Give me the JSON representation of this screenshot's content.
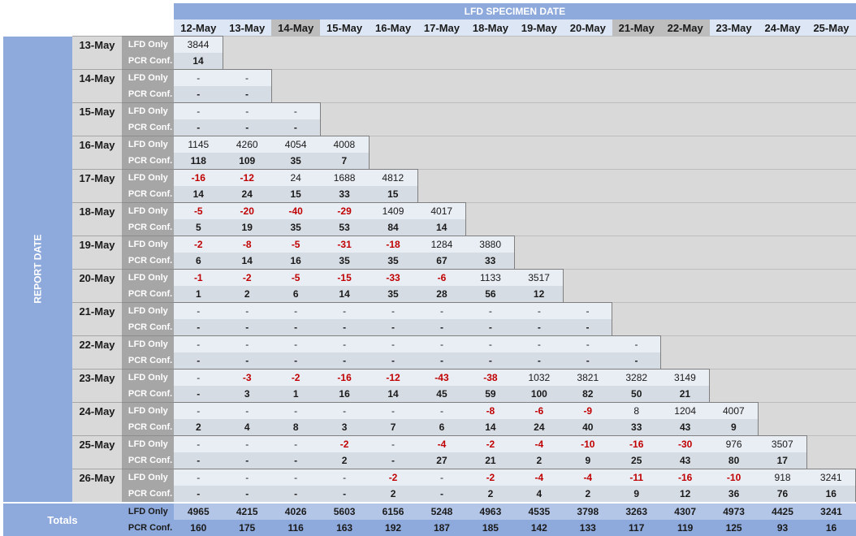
{
  "header": {
    "title": "LFD SPECIMEN DATE"
  },
  "axis_label": "REPORT DATE",
  "specimen_dates": [
    "12-May",
    "13-May",
    "14-May",
    "15-May",
    "16-May",
    "17-May",
    "18-May",
    "19-May",
    "20-May",
    "21-May",
    "22-May",
    "23-May",
    "24-May",
    "25-May"
  ],
  "weekend_columns": [
    2,
    9,
    10
  ],
  "row_types": {
    "lfd": "LFD Only",
    "pcr": "PCR Conf."
  },
  "report_rows": [
    {
      "date": "13-May",
      "lfd": [
        "3844"
      ],
      "pcr": [
        "14"
      ]
    },
    {
      "date": "14-May",
      "lfd": [
        "-",
        "-"
      ],
      "pcr": [
        "-",
        "-"
      ]
    },
    {
      "date": "15-May",
      "lfd": [
        "-",
        "-",
        "-"
      ],
      "pcr": [
        "-",
        "-",
        "-"
      ]
    },
    {
      "date": "16-May",
      "lfd": [
        "1145",
        "4260",
        "4054",
        "4008"
      ],
      "pcr": [
        "118",
        "109",
        "35",
        "7"
      ]
    },
    {
      "date": "17-May",
      "lfd": [
        "-16",
        "-12",
        "24",
        "1688",
        "4812"
      ],
      "pcr": [
        "14",
        "24",
        "15",
        "33",
        "15"
      ]
    },
    {
      "date": "18-May",
      "lfd": [
        "-5",
        "-20",
        "-40",
        "-29",
        "1409",
        "4017"
      ],
      "pcr": [
        "5",
        "19",
        "35",
        "53",
        "84",
        "14"
      ]
    },
    {
      "date": "19-May",
      "lfd": [
        "-2",
        "-8",
        "-5",
        "-31",
        "-18",
        "1284",
        "3880"
      ],
      "pcr": [
        "6",
        "14",
        "16",
        "35",
        "35",
        "67",
        "33"
      ]
    },
    {
      "date": "20-May",
      "lfd": [
        "-1",
        "-2",
        "-5",
        "-15",
        "-33",
        "-6",
        "1133",
        "3517"
      ],
      "pcr": [
        "1",
        "2",
        "6",
        "14",
        "35",
        "28",
        "56",
        "12"
      ]
    },
    {
      "date": "21-May",
      "lfd": [
        "-",
        "-",
        "-",
        "-",
        "-",
        "-",
        "-",
        "-",
        "-"
      ],
      "pcr": [
        "-",
        "-",
        "-",
        "-",
        "-",
        "-",
        "-",
        "-",
        "-"
      ]
    },
    {
      "date": "22-May",
      "lfd": [
        "-",
        "-",
        "-",
        "-",
        "-",
        "-",
        "-",
        "-",
        "-",
        "-"
      ],
      "pcr": [
        "-",
        "-",
        "-",
        "-",
        "-",
        "-",
        "-",
        "-",
        "-",
        "-"
      ]
    },
    {
      "date": "23-May",
      "lfd": [
        "-",
        "-3",
        "-2",
        "-16",
        "-12",
        "-43",
        "-38",
        "1032",
        "3821",
        "3282",
        "3149"
      ],
      "pcr": [
        "-",
        "3",
        "1",
        "16",
        "14",
        "45",
        "59",
        "100",
        "82",
        "50",
        "21"
      ]
    },
    {
      "date": "24-May",
      "lfd": [
        "-",
        "-",
        "-",
        "-",
        "-",
        "-",
        "-8",
        "-6",
        "-9",
        "8",
        "1204",
        "4007"
      ],
      "pcr": [
        "2",
        "4",
        "8",
        "3",
        "7",
        "6",
        "14",
        "24",
        "40",
        "33",
        "43",
        "9"
      ]
    },
    {
      "date": "25-May",
      "lfd": [
        "-",
        "-",
        "-",
        "-2",
        "-",
        "-4",
        "-2",
        "-4",
        "-10",
        "-16",
        "-30",
        "976",
        "3507"
      ],
      "pcr": [
        "-",
        "-",
        "-",
        "2",
        "-",
        "27",
        "21",
        "2",
        "9",
        "25",
        "43",
        "80",
        "17"
      ]
    },
    {
      "date": "26-May",
      "lfd": [
        "-",
        "-",
        "-",
        "-",
        "-2",
        "-",
        "-2",
        "-4",
        "-4",
        "-11",
        "-16",
        "-10",
        "918",
        "3241"
      ],
      "pcr": [
        "-",
        "-",
        "-",
        "-",
        "2",
        "-",
        "2",
        "4",
        "2",
        "9",
        "12",
        "36",
        "76",
        "16"
      ]
    }
  ],
  "totals": {
    "label": "Totals",
    "lfd": [
      "4965",
      "4215",
      "4026",
      "5603",
      "6156",
      "5248",
      "4963",
      "4535",
      "3798",
      "3263",
      "4307",
      "4973",
      "4425",
      "3241"
    ],
    "pcr": [
      "160",
      "175",
      "116",
      "163",
      "192",
      "187",
      "185",
      "142",
      "133",
      "117",
      "119",
      "125",
      "93",
      "16"
    ]
  }
}
